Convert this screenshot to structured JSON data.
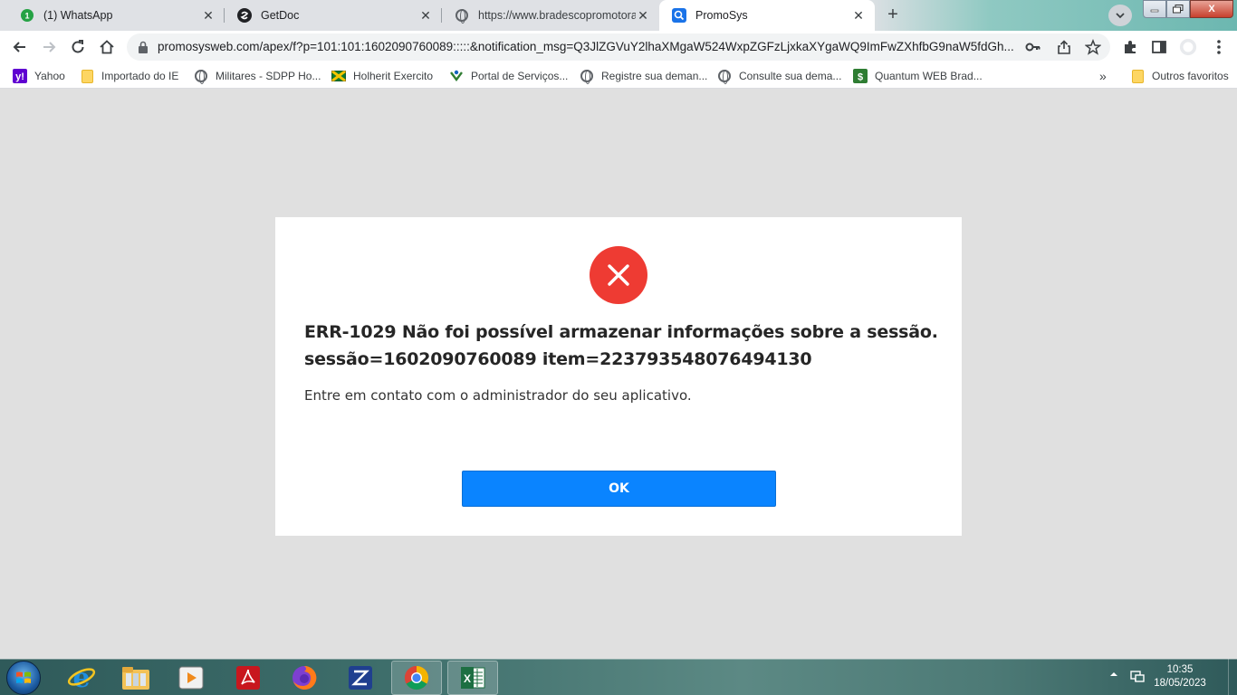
{
  "tabs": [
    {
      "title": "(1) WhatsApp",
      "icon": "whatsapp-icon",
      "badge": "1"
    },
    {
      "title": "GetDoc",
      "icon": "getdoc-icon"
    },
    {
      "title": "https://www.bradescopromotora",
      "icon": "globe-icon"
    },
    {
      "title": "PromoSys",
      "icon": "search-icon",
      "active": true
    }
  ],
  "window_controls": {
    "close": "X"
  },
  "address_bar": {
    "url": "promosysweb.com/apex/f?p=101:101:1602090760089:::::&notification_msg=Q3JlZGVuY2lhaXMgaW524WxpZGFzLjxkaXYgaWQ9ImFwZXhfbG9naW5fdGh..."
  },
  "bookmarks": [
    {
      "label": "Yahoo",
      "icon": "yahoo-icon"
    },
    {
      "label": "Importado do IE",
      "icon": "folder-icon"
    },
    {
      "label": "Militares - SDPP Ho...",
      "icon": "globe-icon"
    },
    {
      "label": "Holherit Exercito",
      "icon": "flag-icon"
    },
    {
      "label": "Portal de Serviços...",
      "icon": "portal-icon"
    },
    {
      "label": "Registre sua deman...",
      "icon": "globe-icon"
    },
    {
      "label": "Consulte sua dema...",
      "icon": "globe-icon"
    },
    {
      "label": "Quantum WEB Brad...",
      "icon": "quantum-icon"
    }
  ],
  "other_bookmarks": "Outros favoritos",
  "more_bookmarks": "»",
  "dialog": {
    "title_line1": "ERR-1029 Não foi possível armazenar informações sobre a sessão.",
    "title_line2": "sessão=1602090760089 item=223793548076494130",
    "message": "Entre em contato com o administrador do seu aplicativo.",
    "ok_label": "OK"
  },
  "taskbar": {
    "apps": [
      "internet-explorer",
      "file-explorer",
      "media-player",
      "adobe-reader",
      "firefox",
      "app-z",
      "chrome",
      "excel"
    ],
    "time": "10:35",
    "date": "18/05/2023"
  },
  "colors": {
    "error_red": "#ee3b33",
    "ok_blue": "#0a84ff",
    "page_bg": "#e0e0e0"
  }
}
